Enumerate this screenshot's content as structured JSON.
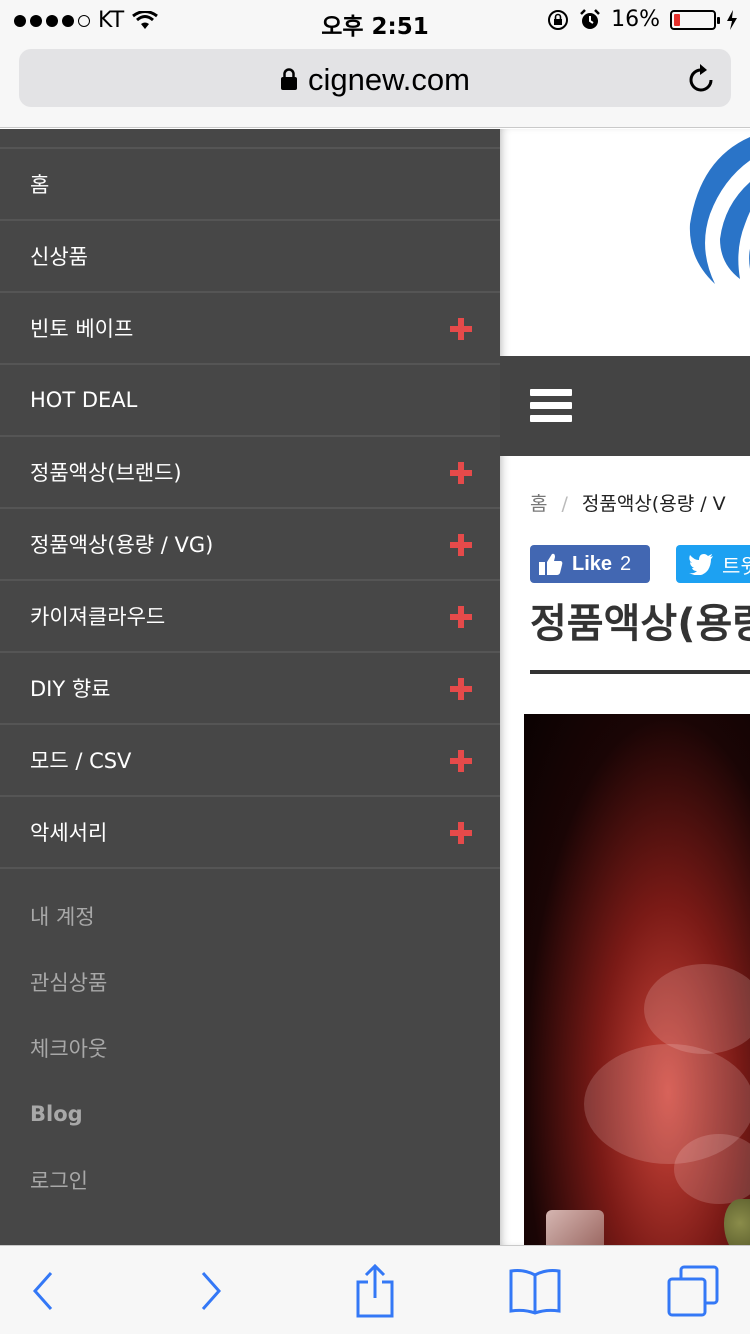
{
  "status_bar": {
    "carrier": "KT",
    "time": "오후 2:51",
    "battery_percent": "16%",
    "battery_level": 0.16
  },
  "address_bar": {
    "url": "cignew.com"
  },
  "sidebar": {
    "menu_items": [
      {
        "label": "홈",
        "expandable": false
      },
      {
        "label": "신상품",
        "expandable": false
      },
      {
        "label": "빈토 베이프",
        "expandable": true
      },
      {
        "label": "HOT DEAL",
        "expandable": false
      },
      {
        "label": "정품액상(브랜드)",
        "expandable": true
      },
      {
        "label": "정품액상(용량 / VG)",
        "expandable": true
      },
      {
        "label": "카이져클라우드",
        "expandable": true
      },
      {
        "label": "DIY 향료",
        "expandable": true
      },
      {
        "label": "모드 / CSV",
        "expandable": true
      },
      {
        "label": "악세서리",
        "expandable": true
      }
    ],
    "sub_links": [
      {
        "label": "내 계정"
      },
      {
        "label": "관심상품"
      },
      {
        "label": "체크아웃"
      },
      {
        "label": "Blog"
      },
      {
        "label": "로그인"
      }
    ]
  },
  "main": {
    "breadcrumb": {
      "home": "홈",
      "separator": "/",
      "current": "정품액상(용량 / V"
    },
    "like_button": {
      "label": "Like",
      "count": "2"
    },
    "tweet_button": {
      "label": "트윗"
    },
    "page_title": "정품액상(용량"
  },
  "colors": {
    "sidebar_bg": "#474747",
    "plus_accent": "#e54a4a",
    "nav_bar_bg": "#444444",
    "facebook_blue": "#4267b2",
    "twitter_blue": "#1da1f2",
    "logo_blue": "#2a74c8",
    "ios_tint": "#3478f6"
  }
}
